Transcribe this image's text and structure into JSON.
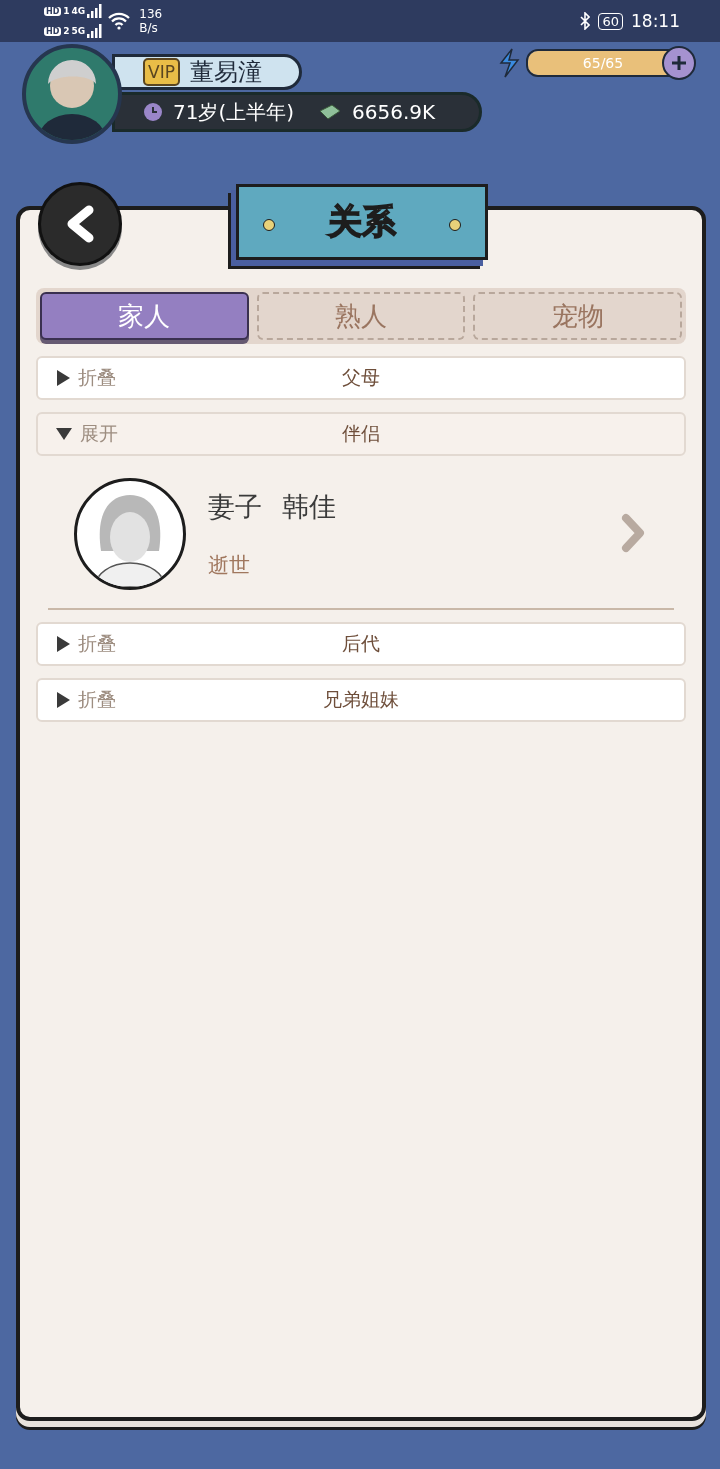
{
  "status_bar": {
    "sims": [
      {
        "hd": "HD",
        "slot": "1",
        "network": "4G"
      },
      {
        "hd": "HD",
        "slot": "2",
        "network": "5G"
      }
    ],
    "speed": "136",
    "speed_unit": "B/s",
    "battery": "60",
    "time": "18:11"
  },
  "player": {
    "vip": "VIP",
    "name": "董易潼",
    "age": "71岁(上半年)",
    "money": "6656.9K"
  },
  "energy": {
    "reading": "65/65",
    "level": 1
  },
  "title": "关系",
  "tabs": [
    {
      "label": "家人",
      "selected": true
    },
    {
      "label": "熟人",
      "selected": false
    },
    {
      "label": "宠物",
      "selected": false
    }
  ],
  "groups": [
    {
      "toggle": "折叠",
      "title": "父母",
      "expanded": false
    },
    {
      "toggle": "展开",
      "title": "伴侣",
      "expanded": true,
      "members": [
        {
          "relation": "妻子",
          "name": "韩佳",
          "status": "逝世"
        }
      ]
    },
    {
      "toggle": "折叠",
      "title": "后代",
      "expanded": false
    },
    {
      "toggle": "折叠",
      "title": "兄弟姐妹",
      "expanded": false
    }
  ]
}
